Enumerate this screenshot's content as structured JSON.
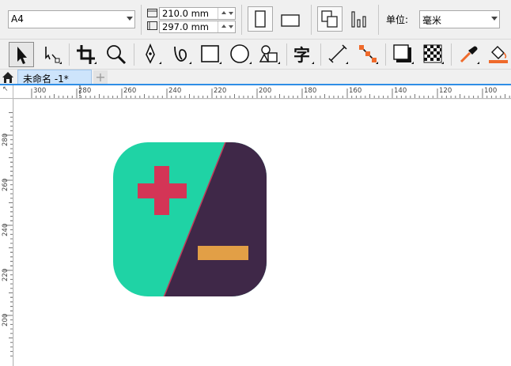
{
  "property_bar": {
    "page_size": "A4",
    "width_value": "210.0 mm",
    "height_value": "297.0 mm",
    "units_label": "单位:",
    "units_value": "毫米"
  },
  "tabs": [
    {
      "label": "未命名 -1*"
    }
  ],
  "tab_add_symbol": "+",
  "ruler_h_labels": [
    "300",
    "280",
    "260",
    "240",
    "220",
    "200",
    "180",
    "160",
    "140",
    "120",
    "100"
  ],
  "ruler_v_labels": [
    "280",
    "260",
    "240",
    "220",
    "200"
  ],
  "ruler_corner_glyph": "↖",
  "artwork": {
    "left_color": "#1fd3a5",
    "right_color": "#3f2848",
    "plus_color": "#d43556",
    "minus_color": "#e29f46",
    "divider_color": "#c23a5a"
  },
  "tools": [
    {
      "name": "pick-tool-icon"
    },
    {
      "name": "shape-tool-icon"
    },
    {
      "name": "crop-tool-icon"
    },
    {
      "name": "zoom-tool-icon"
    },
    {
      "name": "pen-tool-icon"
    },
    {
      "name": "artistic-media-icon"
    },
    {
      "name": "rectangle-tool-icon"
    },
    {
      "name": "ellipse-tool-icon"
    },
    {
      "name": "polygon-tool-icon"
    },
    {
      "name": "text-tool-icon"
    },
    {
      "name": "dimension-tool-icon"
    },
    {
      "name": "connector-tool-icon"
    },
    {
      "name": "drop-shadow-tool-icon"
    },
    {
      "name": "transparency-tool-icon"
    },
    {
      "name": "eyedropper-tool-icon"
    },
    {
      "name": "fill-tool-icon"
    }
  ]
}
